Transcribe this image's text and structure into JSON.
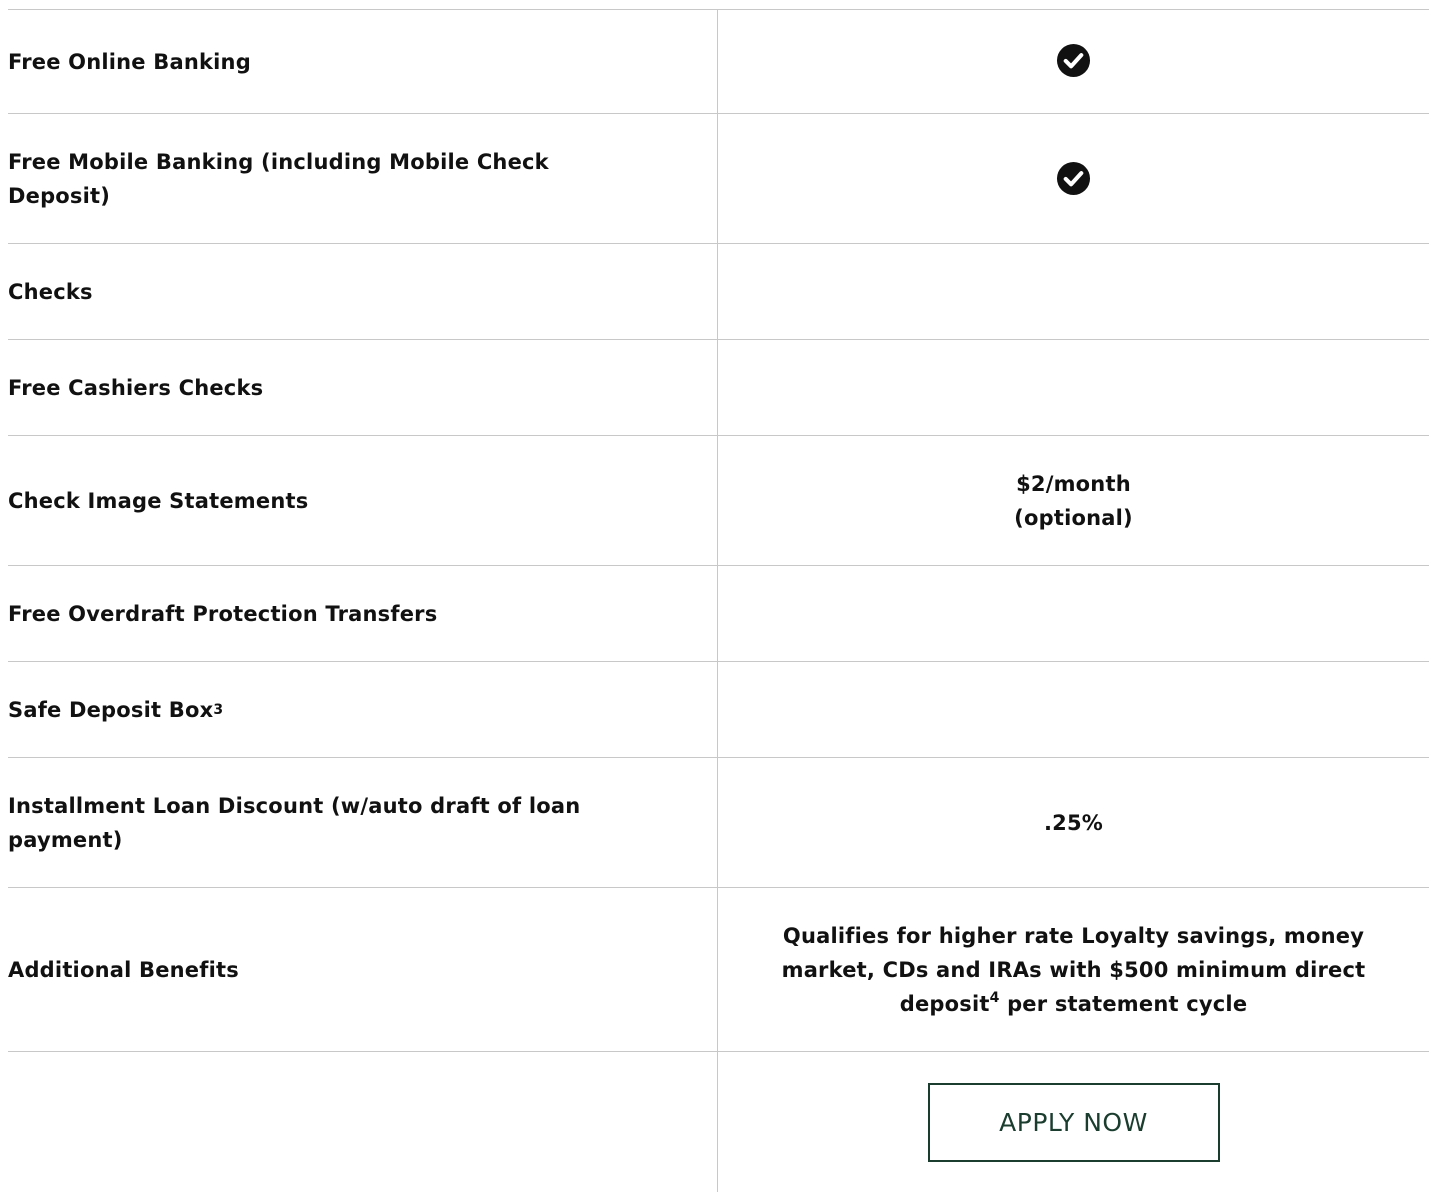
{
  "rows": [
    {
      "label": "Free Online Banking",
      "value_type": "check",
      "icon": "check-circle-icon"
    },
    {
      "label": "Free Mobile Banking (including Mobile Check Deposit)",
      "value_type": "check",
      "icon": "check-circle-icon"
    },
    {
      "label": "Checks",
      "value_type": "empty"
    },
    {
      "label": "Free Cashiers Checks",
      "value_type": "empty"
    },
    {
      "label": "Check Image Statements",
      "value_line1": "$2/month",
      "value_line2": "(optional)"
    },
    {
      "label": "Free Overdraft Protection Transfers",
      "value_type": "empty"
    },
    {
      "label": "Safe Deposit Box",
      "label_sup": "3",
      "value_type": "empty"
    },
    {
      "label": "Installment Loan Discount (w/auto draft of loan payment)",
      "value": ".25%"
    },
    {
      "label": "Additional Benefits",
      "value_part1": "Qualifies for higher rate Loyalty savings, money market, CDs and IRAs with $500 minimum direct deposit",
      "value_sup": "4",
      "value_part2": " per statement cycle"
    }
  ],
  "apply_button": {
    "label": "APPLY NOW"
  },
  "colors": {
    "border": "#c8c8c8",
    "text": "#111111",
    "button_accent": "#1b3d2f",
    "check_icon": "#111111"
  }
}
